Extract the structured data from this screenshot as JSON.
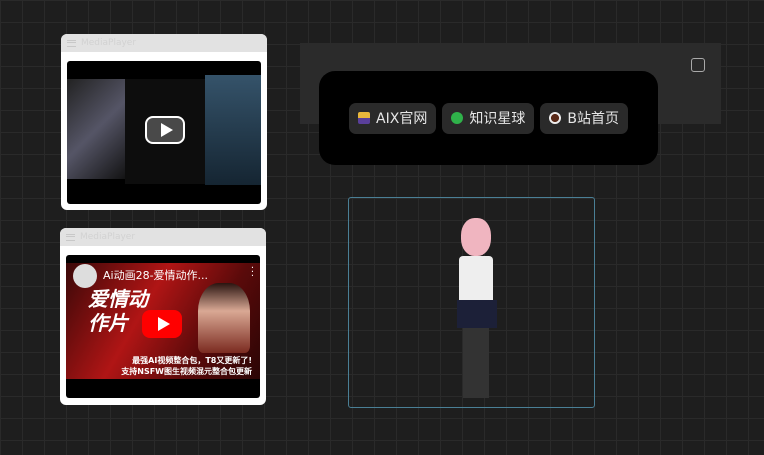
{
  "cards": [
    {
      "title": "MediaPlayer"
    },
    {
      "title": "MediaPlayer",
      "video_title": "Ai动画28-爱情动作...",
      "thumb_big": "爱情动作片",
      "caption1": "最强AI视频整合包，T8又更新了!",
      "caption2": "支持NSFW图生视频混元整合包更新"
    }
  ],
  "links": [
    {
      "label": "AIX官网",
      "icon": "folder-icon",
      "color": "#e9b73c"
    },
    {
      "label": "知识星球",
      "icon": "bug-icon",
      "color": "#2fb24a"
    },
    {
      "label": "B站首页",
      "icon": "coffee-icon",
      "color": "#7a3b23"
    }
  ]
}
